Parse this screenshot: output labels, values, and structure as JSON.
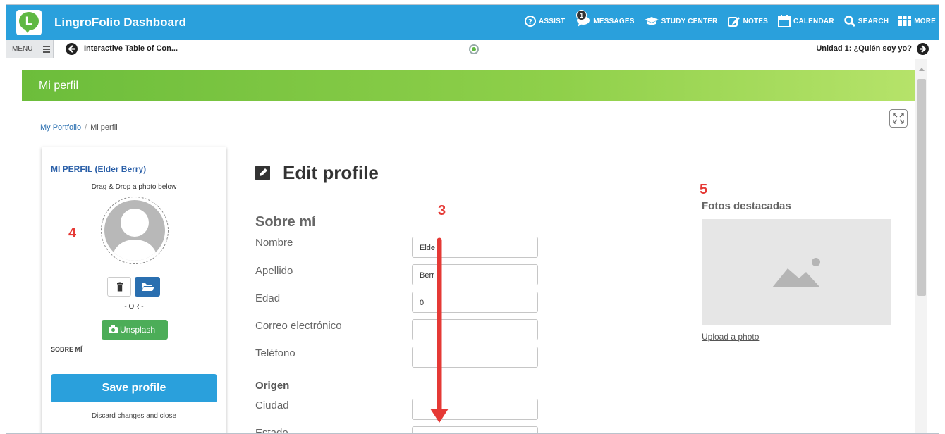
{
  "app": {
    "title": "LingroFolio Dashboard",
    "logo_letter": "L"
  },
  "topnav": [
    {
      "label": "ASSIST",
      "icon": "question-circle-icon"
    },
    {
      "label": "MESSAGES",
      "icon": "chat-bubble-icon",
      "badge": "1"
    },
    {
      "label": "STUDY CENTER",
      "icon": "graduation-cap-icon"
    },
    {
      "label": "NOTES",
      "icon": "edit-note-icon"
    },
    {
      "label": "CALENDAR",
      "icon": "calendar-icon"
    },
    {
      "label": "SEARCH",
      "icon": "search-icon"
    },
    {
      "label": "MORE",
      "icon": "grid-icon"
    }
  ],
  "subbar": {
    "menu_label": "MENU",
    "toc_label": "Interactive Table of Con...",
    "unit_label": "Unidad 1: ¿Quién soy yo?"
  },
  "page": {
    "banner_title": "Mi perfil",
    "breadcrumb": [
      "My Portfolio",
      "Mi perfil"
    ],
    "breadcrumb_sep": "/"
  },
  "left_panel": {
    "profile_link": "MI PERFIL (Elder Berry)",
    "drag_text": "Drag & Drop a photo below",
    "or_text": "- OR -",
    "unsplash_label": "Unsplash",
    "sobre_label": "SOBRE MÍ",
    "save_label": "Save profile",
    "discard_label": "Discard changes and close"
  },
  "form": {
    "title": "Edit profile",
    "section_about": "Sobre mí",
    "section_origin": "Origen",
    "fields": [
      {
        "label": "Nombre",
        "value": "Elde"
      },
      {
        "label": "Apellido",
        "value": "Berr"
      },
      {
        "label": "Edad",
        "value": "0"
      },
      {
        "label": "Correo electrónico",
        "value": ""
      },
      {
        "label": "Teléfono",
        "value": ""
      },
      {
        "label": "Ciudad",
        "value": ""
      },
      {
        "label": "Estado",
        "value": ""
      }
    ]
  },
  "photos": {
    "heading": "Fotos destacadas",
    "upload_label": "Upload a photo"
  },
  "annotations": [
    "3",
    "4",
    "5"
  ],
  "colors": {
    "topbar": "#2aa0dc",
    "banner": "#8fd04a",
    "annotation": "#e53935",
    "save_button": "#2aa0dc",
    "unsplash_button": "#4cad58"
  }
}
